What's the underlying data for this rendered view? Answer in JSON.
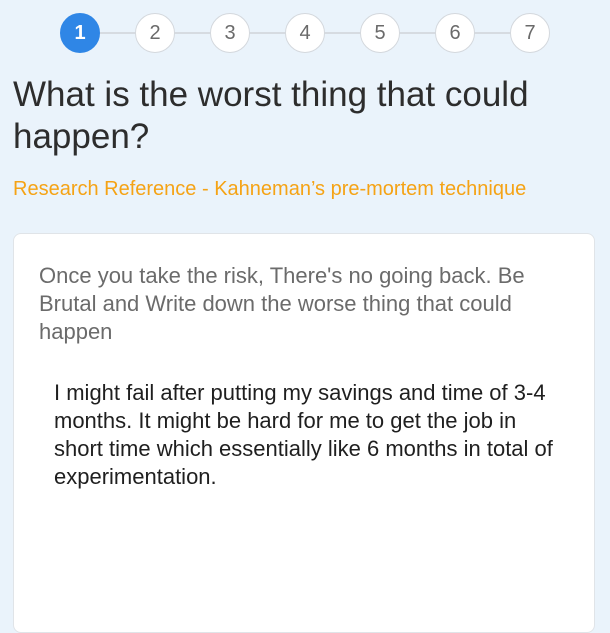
{
  "stepper": {
    "steps": [
      "1",
      "2",
      "3",
      "4",
      "5",
      "6",
      "7"
    ],
    "active_step": "1"
  },
  "question": {
    "title": "What is the worst thing that could happen?",
    "reference": "Research Reference - Kahneman’s pre-mortem technique"
  },
  "card": {
    "prompt": "Once you take the risk, There's no going back. Be Brutal and Write down the worse thing that could happen",
    "answer": "I might fail after putting my savings and time of 3-4 months. It might be hard for me to get the job in short time which essentially like 6 months in total of experimentation."
  },
  "colors": {
    "background": "#eaf3fb",
    "accent": "#2f86e6",
    "reference": "#f5a315"
  }
}
